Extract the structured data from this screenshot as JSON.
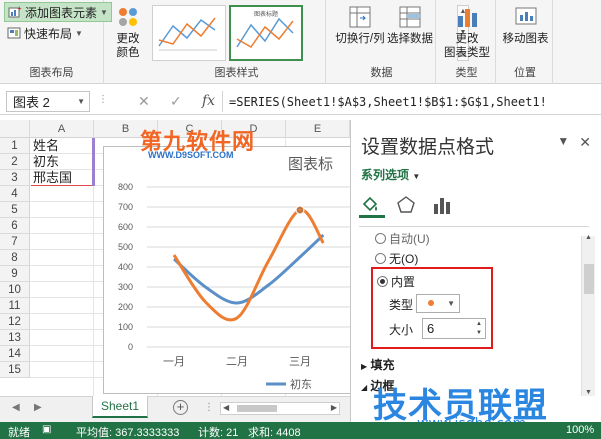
{
  "ribbon": {
    "chart_layout": {
      "add_element": "添加图表元素",
      "quick_layout": "快速布局",
      "label": "图表布局"
    },
    "change_colors": {
      "line1": "更改",
      "line2": "颜色"
    },
    "chart_styles": {
      "label": "图表样式",
      "thumb2_title": "图表标题"
    },
    "data": {
      "switch_row_col": "切换行/列",
      "select_data": "选择数据",
      "label": "数据"
    },
    "type": {
      "line1": "更改",
      "line2": "图表类型",
      "label": "类型"
    },
    "location": {
      "move_chart": "移动图表",
      "label": "位置"
    }
  },
  "formula_bar": {
    "name_box": "图表 2",
    "formula": "=SERIES(Sheet1!$A$3,Sheet1!$B$1:$G$1,Sheet1!"
  },
  "grid": {
    "columns": [
      "A",
      "B",
      "C",
      "D",
      "E",
      "F"
    ],
    "rows": [
      "1",
      "2",
      "3",
      "4",
      "5",
      "6",
      "7",
      "8",
      "9",
      "10",
      "11",
      "12",
      "13",
      "14",
      "15"
    ],
    "cells": {
      "a1": "姓名",
      "a2": "初东",
      "a3": "邢志国"
    }
  },
  "chart_data": {
    "type": "line",
    "title": "图表标",
    "categories": [
      "一月",
      "二月",
      "三月"
    ],
    "yticks": [
      "0",
      "100",
      "200",
      "300",
      "400",
      "500",
      "600",
      "700",
      "800"
    ],
    "ylim": [
      0,
      800
    ],
    "series": [
      {
        "name": "初东",
        "x": [
          0,
          0.5,
          1,
          1.5,
          2,
          2.37
        ],
        "values": [
          440,
          300,
          220,
          310,
          450,
          560
        ],
        "color": "#5b8fc7"
      },
      {
        "x": [
          0,
          0.5,
          1,
          1.5,
          2,
          2.37
        ],
        "values": [
          460,
          225,
          145,
          430,
          685,
          520
        ],
        "color": "#ed7d31"
      }
    ],
    "legend": "bottom",
    "selected_point": {
      "series": 1,
      "x": 2,
      "y": 685
    }
  },
  "watermark": {
    "top": "第九软件网",
    "top_sub": "WWW.D9SOFT.COM",
    "bottom": "技术员联盟",
    "url": "www.jsgho.com"
  },
  "format_pane": {
    "title": "设置数据点格式",
    "series_options": "系列选项",
    "opt_auto": "自动(U)",
    "opt_none": "无(O)",
    "opt_builtin": "内置",
    "type_label": "类型",
    "size_label": "大小",
    "size_value": "6",
    "fill": "填充",
    "border": "边框",
    "accent_color": "#217346",
    "marker_color": "#ed7d31"
  },
  "sheet_tabs": {
    "active": "Sheet1",
    "add": "+"
  },
  "status_bar": {
    "ready": "就绪",
    "average": "平均值: 367.3333333",
    "count": "计数: 21",
    "sum": "求和: 4408",
    "zoom": "100%"
  }
}
